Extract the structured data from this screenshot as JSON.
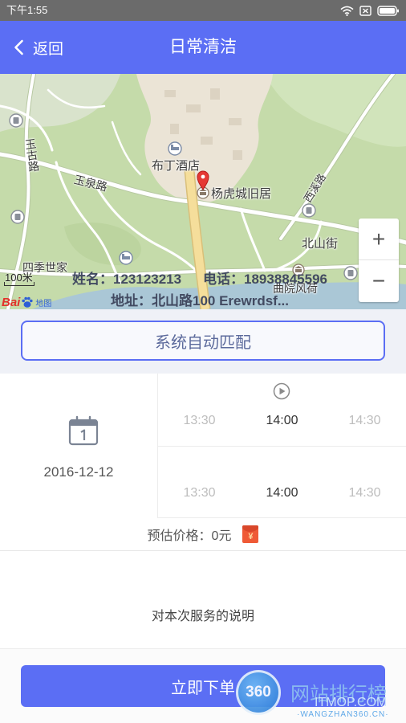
{
  "status_bar": {
    "time": "下午1:55",
    "icons": [
      "wifi-icon",
      "sim-icon",
      "battery-icon"
    ]
  },
  "header": {
    "back_icon": "chevron-left-icon",
    "back_label": "返回",
    "title": "日常清洁"
  },
  "map": {
    "labels": {
      "yugu_road": "玉古路",
      "buding_hotel": "布丁酒店",
      "yanghucheng_residence": "杨虎城旧居",
      "yuquan_road": "玉泉路",
      "xixi_road": "西溪路",
      "beishan_street": "北山街",
      "siji_shijia": "四季世家",
      "quyuan_fenghe": "曲院风荷"
    },
    "scale_label": "100米",
    "logo": {
      "left": "Bai",
      "right": "地图",
      "icon": "baidu-paw-icon"
    },
    "marker_icon": "location-pin-icon",
    "zoom_in_label": "+",
    "zoom_out_label": "−",
    "customer": {
      "name": "姓名：123123213",
      "phone": "电话：18938845596",
      "address": "地址：北山路100 Erewrdsf..."
    }
  },
  "match_button_label": "系统自动匹配",
  "schedule": {
    "calendar_icon": "calendar-icon",
    "date": "2016-12-12",
    "rows": [
      {
        "icon": "play-circle-icon",
        "times": [
          "13:30",
          "14:00",
          "14:30"
        ],
        "selected_index": 1
      },
      {
        "times": [
          "13:30",
          "14:00",
          "14:30"
        ],
        "selected_index": 1
      }
    ]
  },
  "price": {
    "label": "预估价格：0元",
    "icon": "red-envelope-icon",
    "icon_symbol": "¥"
  },
  "description_label": "对本次服务的说明",
  "submit_button_label": "立即下单",
  "watermark": {
    "badge": "360",
    "name": "网站排行榜",
    "site": "ITMOP.COM",
    "domain": "·WANGZHAN360.CN·"
  },
  "colors": {
    "accent": "#5b6ef4",
    "status_bar": "#6b6b6b",
    "map_pin": "#e53935",
    "price_icon": "#ef5a36",
    "muted_time": "#bdbdbd",
    "active_time": "#333333"
  }
}
